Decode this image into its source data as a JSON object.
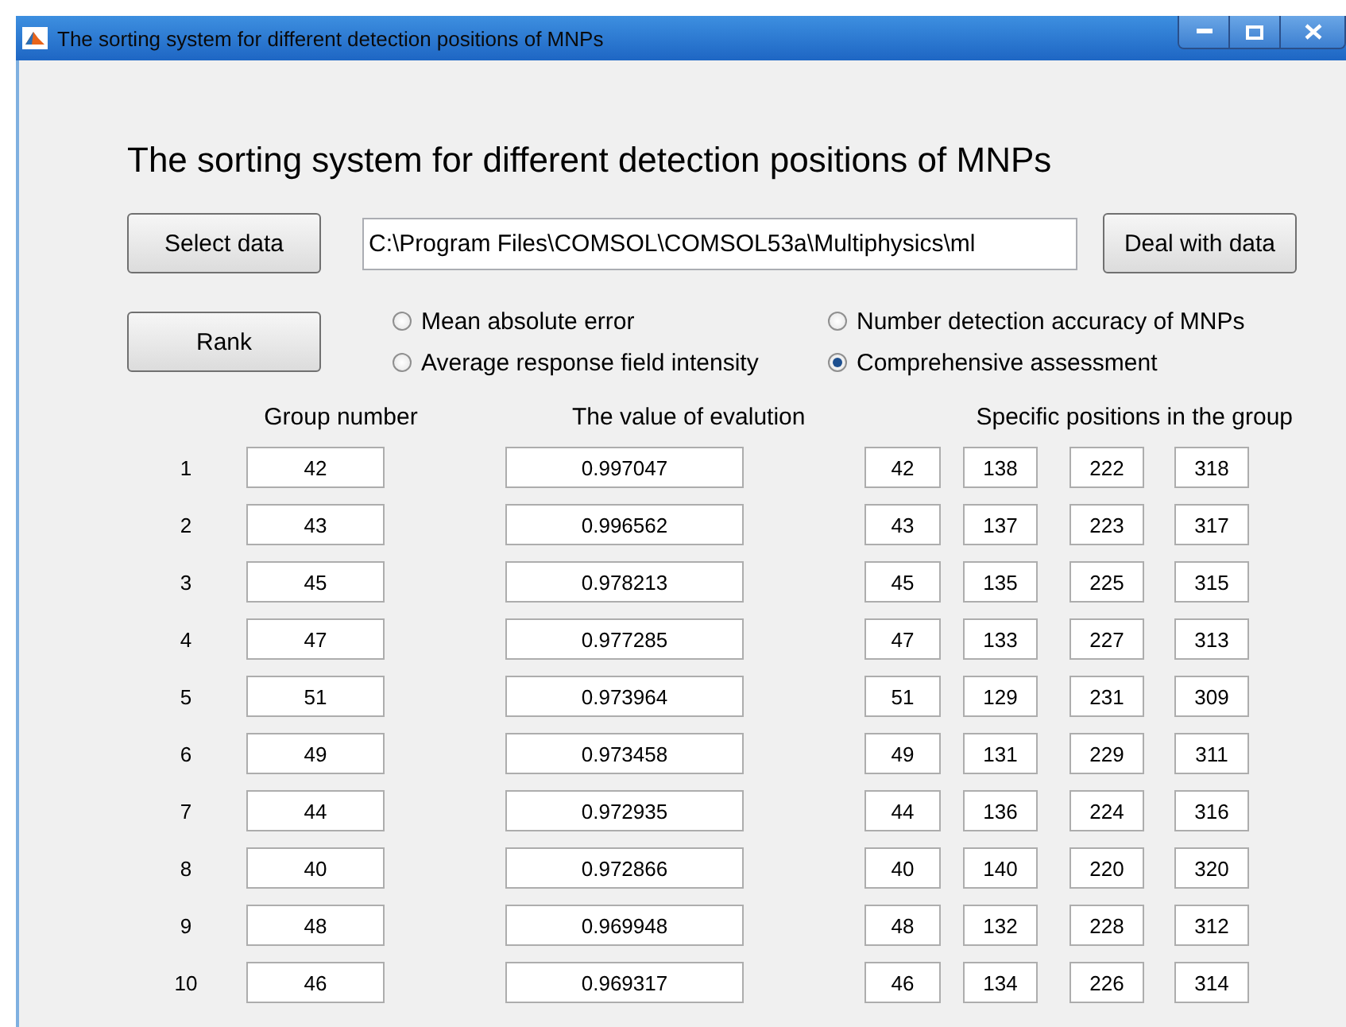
{
  "window": {
    "title": "The sorting system for different detection positions of MNPs"
  },
  "heading": "The sorting system for different detection positions of MNPs",
  "select_button": "Select data",
  "path_field": {
    "value": "C:\\Program Files\\COMSOL\\COMSOL53a\\Multiphysics\\ml"
  },
  "deal_button": "Deal with data",
  "rank_button": "Rank",
  "criteria": [
    {
      "label": "Mean absolute error",
      "selected": false
    },
    {
      "label": "Number detection accuracy of MNPs",
      "selected": false
    },
    {
      "label": "Average response field intensity",
      "selected": false
    },
    {
      "label": "Comprehensive assessment",
      "selected": true
    }
  ],
  "table": {
    "columns": [
      "Group number",
      "The value of evalution",
      "Specific positions in the group"
    ],
    "rows": [
      {
        "rank": "1",
        "group": "42",
        "value": "0.997047",
        "positions": [
          "42",
          "138",
          "222",
          "318"
        ]
      },
      {
        "rank": "2",
        "group": "43",
        "value": "0.996562",
        "positions": [
          "43",
          "137",
          "223",
          "317"
        ]
      },
      {
        "rank": "3",
        "group": "45",
        "value": "0.978213",
        "positions": [
          "45",
          "135",
          "225",
          "315"
        ]
      },
      {
        "rank": "4",
        "group": "47",
        "value": "0.977285",
        "positions": [
          "47",
          "133",
          "227",
          "313"
        ]
      },
      {
        "rank": "5",
        "group": "51",
        "value": "0.973964",
        "positions": [
          "51",
          "129",
          "231",
          "309"
        ]
      },
      {
        "rank": "6",
        "group": "49",
        "value": "0.973458",
        "positions": [
          "49",
          "131",
          "229",
          "311"
        ]
      },
      {
        "rank": "7",
        "group": "44",
        "value": "0.972935",
        "positions": [
          "44",
          "136",
          "224",
          "316"
        ]
      },
      {
        "rank": "8",
        "group": "40",
        "value": "0.972866",
        "positions": [
          "40",
          "140",
          "220",
          "320"
        ]
      },
      {
        "rank": "9",
        "group": "48",
        "value": "0.969948",
        "positions": [
          "48",
          "132",
          "228",
          "312"
        ]
      },
      {
        "rank": "10",
        "group": "46",
        "value": "0.969317",
        "positions": [
          "46",
          "134",
          "226",
          "314"
        ]
      }
    ]
  }
}
